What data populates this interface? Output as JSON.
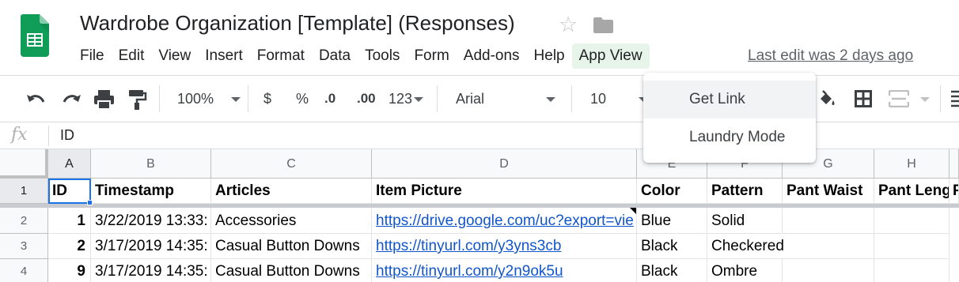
{
  "header": {
    "doc_title": "Wardrobe Organization [Template] (Responses)",
    "last_edit": "Last edit was 2 days ago"
  },
  "menu": [
    "File",
    "Edit",
    "View",
    "Insert",
    "Format",
    "Data",
    "Tools",
    "Form",
    "Add-ons",
    "Help",
    "App View"
  ],
  "toolbar": {
    "zoom": "100%",
    "currency": "$",
    "percent": "%",
    "decimal_decrease": ".0",
    "decimal_increase": ".00",
    "more_formats": "123",
    "font": "Arial",
    "font_size": "10"
  },
  "formula_bar": {
    "fx": "fx",
    "value": "ID"
  },
  "grid": {
    "columns": [
      "A",
      "B",
      "C",
      "D",
      "E",
      "F",
      "G",
      "H"
    ],
    "rows": [
      "1",
      "2",
      "3",
      "4"
    ],
    "header_row": [
      "ID",
      "Timestamp",
      "Articles",
      "Item Picture",
      "Color",
      "Pattern",
      "Pant Waist",
      "Pant Leng",
      "P"
    ],
    "data": [
      [
        "1",
        "3/22/2019 13:33:",
        "Accessories",
        "https://drive.google.com/uc?export=vie",
        "Blue",
        "Solid"
      ],
      [
        "2",
        "3/17/2019 14:35:",
        "Casual Button Downs",
        "https://tinyurl.com/y3yns3cb",
        "Black",
        "Checkered"
      ],
      [
        "9",
        "3/17/2019 14:35:",
        "Casual Button Downs",
        "https://tinyurl.com/y2n9ok5u",
        "Black",
        "Ombre"
      ]
    ]
  },
  "dropdown": {
    "items": [
      "Get Link",
      "Laundry Mode"
    ]
  },
  "colors": {
    "selection": "#1a73e8",
    "link": "#1155cc",
    "menu_active": "#e6f4ea",
    "sheets_green": "#0f9d58"
  }
}
